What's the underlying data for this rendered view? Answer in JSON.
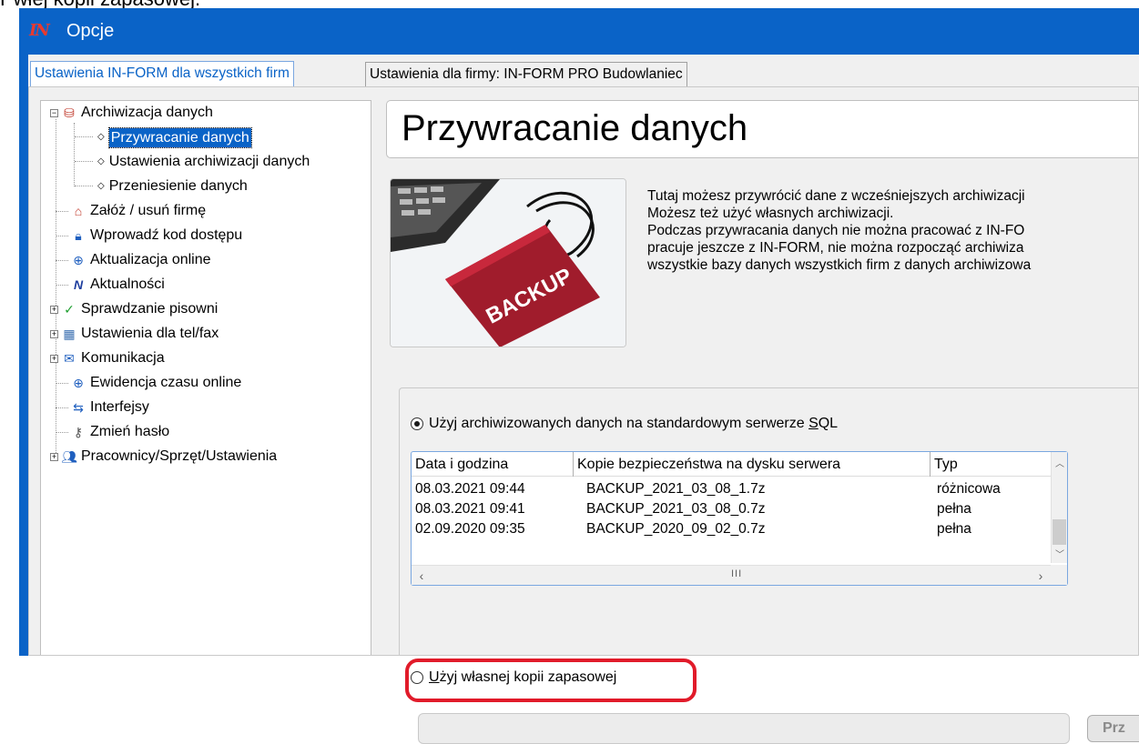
{
  "caption_text": "Pwłej kopii zapasowej.",
  "window": {
    "logo_text": "IN",
    "title": "Opcje"
  },
  "tabs": [
    {
      "label": "Ustawienia IN-FORM dla wszystkich firm",
      "active": true
    },
    {
      "label": "Ustawienia dla firmy: IN-FORM PRO Budowlaniec",
      "active": false
    }
  ],
  "tree": {
    "items": [
      {
        "label": "Archiwizacja danych",
        "icon": "archive-icon",
        "expander": "−"
      },
      {
        "label": "Przywracanie danych",
        "selected": true
      },
      {
        "label": "Ustawienia archiwizacji danych"
      },
      {
        "label": "Przeniesienie danych"
      },
      {
        "label": "Załóż / usuń firmę",
        "icon": "house-icon"
      },
      {
        "label": "Wprowadź kod dostępu",
        "icon": "lock-icon"
      },
      {
        "label": "Aktualizacja online",
        "icon": "globe-icon"
      },
      {
        "label": "Aktualności",
        "icon": "inform-logo-icon"
      },
      {
        "label": "Sprawdzanie pisowni",
        "icon": "checkmark-icon",
        "expander": "+"
      },
      {
        "label": "Ustawienia dla tel/fax",
        "icon": "fax-icon",
        "expander": "+"
      },
      {
        "label": "Komunikacja",
        "icon": "envelope-icon",
        "expander": "+"
      },
      {
        "label": "Ewidencja czasu online",
        "icon": "globe-icon"
      },
      {
        "label": "Interfejsy",
        "icon": "arrows-icon"
      },
      {
        "label": "Zmień hasło",
        "icon": "key-icon"
      },
      {
        "label": "Pracownicy/Sprzęt/Ustawienia",
        "icon": "people-icon",
        "expander": "+"
      }
    ]
  },
  "main": {
    "page_title": "Przywracanie danych",
    "image_label": "BACKUP",
    "description": [
      "Tutaj możesz przywrócić dane z wcześniejszych archiwizacji",
      "Możesz też użyć własnych archiwizacji.",
      "Podczas przywracania danych nie można pracować z IN-FO",
      "pracuje jeszcze z IN-FORM, nie można rozpocząć archiwiza",
      "wszystkie bazy danych wszystkich firm z danych archiwizowa"
    ],
    "option_sql": {
      "label_prefix": "Użyj archiwizowanych danych na standardowym serwerze ",
      "label_underlined": "S",
      "label_suffix": "QL",
      "checked": true
    },
    "backup_table": {
      "columns": [
        "Data i godzina",
        "Kopie bezpieczeństwa na dysku serwera",
        "Typ"
      ],
      "rows": [
        [
          "08.03.2021 09:44",
          "BACKUP_2021_03_08_1.7z",
          "różnicowa"
        ],
        [
          "08.03.2021 09:41",
          "BACKUP_2021_03_08_0.7z",
          "pełna"
        ],
        [
          "02.09.2020 09:35",
          "BACKUP_2020_09_02_0.7z",
          "pełna"
        ]
      ]
    },
    "option_own": {
      "label_underlined": "U",
      "label_suffix": "żyj własnej kopii zapasowej",
      "checked": false
    },
    "path_value": "",
    "browse_label": "Prz"
  },
  "colors": {
    "window_blue": "#0a63c7",
    "highlight_red": "#e11b2a"
  }
}
